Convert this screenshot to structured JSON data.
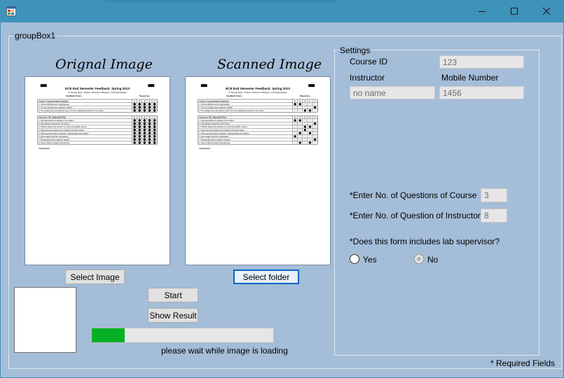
{
  "window": {
    "minimize_glyph": "—",
    "maximize_glyph": "☐",
    "close_glyph": "✕"
  },
  "groupbox_main": {
    "label": "groupBox1"
  },
  "groupbox_settings": {
    "label": "Settings"
  },
  "original": {
    "heading": "Orignal Image",
    "select_button": "Select Image"
  },
  "scanned": {
    "heading": "Scanned Image",
    "select_button": "Select folder"
  },
  "document": {
    "title": "ECE End Semester Feedback: Spring 2013",
    "scale": "5= Strongly Agree, 4=Agree, 3=Neutral, 2=Disagree, 1=Strongly Disagree",
    "col_topics": "Feedback Topics",
    "col_responses": "Responses",
    "section1": "Course: Communication Systems",
    "section2": "Instructor:  Mr. Jahanzaib Khan",
    "scale_nums": [
      "5",
      "4",
      "3",
      "2",
      "1"
    ],
    "course_questions": [
      "1. Course difficulty level is appropriate",
      "2. The text book/course material is helpful",
      "3. The assignments and quizzes came from the materials presented in the lecture"
    ],
    "instructor_questions": [
      "1. Had appropriate knowledge of the subject",
      "2. Was always prepared for the lecture",
      "3. He/She delivers the lectures in a loud and audible manner",
      "4. Had good presentation and explained concepts clearly",
      "5. Was concerned about students' understanding and progress",
      "6. Encouraged students' participation",
      "7. Responded well to students' queries",
      "8. Gave sufficient assignments/quizzes"
    ],
    "comments": "Comments:"
  },
  "buttons": {
    "start": "Start",
    "show_result": "Show Result"
  },
  "progress": {
    "fraction": 0.18,
    "status": "please wait while image is loading"
  },
  "settings": {
    "course_id_label": "Course ID",
    "course_id_value": "123",
    "instructor_label": "Instructor",
    "instructor_value": "no name",
    "mobile_label": "Mobile Number",
    "mobile_value": "1456",
    "q_course_label": "*Enter No. of Questions of Course",
    "q_course_value": "3",
    "q_instructor_label": "*Enter No. of Question of Instructor",
    "q_instructor_value": "8",
    "lab_question": "*Does this form includes lab supervisor?",
    "yes_label": "Yes",
    "no_label": "No"
  },
  "footer": {
    "required_note": "* Required Fields"
  },
  "colors": {
    "titlebar": "#3f92b9",
    "client": "#a4bdd8",
    "progress_fill": "#06b025",
    "focus_border": "#0a64c8"
  }
}
